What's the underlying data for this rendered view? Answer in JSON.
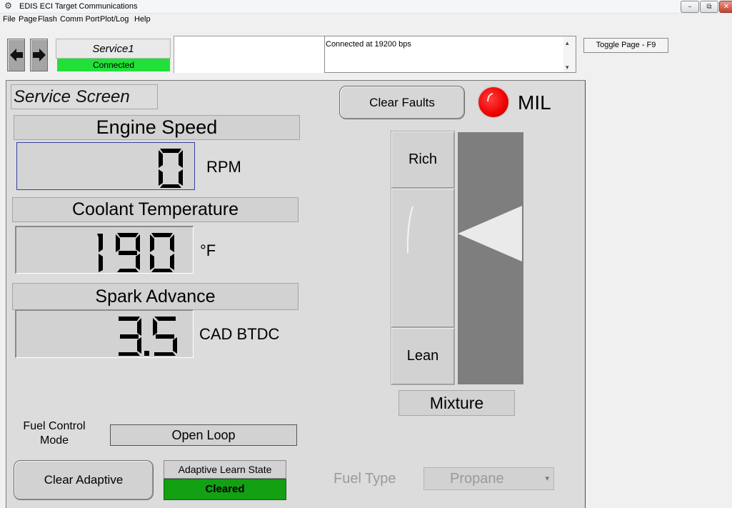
{
  "window": {
    "title": "EDIS ECI Target Communications",
    "app_icon": "app-logo-icon",
    "controls": {
      "minimize": "–",
      "maximize": "⧉",
      "close": "✕"
    }
  },
  "menu": [
    "File",
    "Page",
    "Flash",
    "Comm Port",
    "Plot/Log",
    "Help"
  ],
  "toolbar": {
    "back_icon": "arrow-left-icon",
    "forward_icon": "arrow-right-icon",
    "page_name": "Service1",
    "page_status": "Connected",
    "log_text": "Connected at 19200 bps",
    "log_scroll_up": "▴",
    "log_scroll_down": "▾",
    "toggle_page": "Toggle Page - F9"
  },
  "service": {
    "title": "Service Screen",
    "engine_speed": {
      "label": "Engine Speed",
      "value": "0",
      "unit": "RPM"
    },
    "coolant_temp": {
      "label": "Coolant Temperature",
      "value": "190",
      "unit": "°F"
    },
    "spark_advance": {
      "label": "Spark Advance",
      "value": "3.5",
      "unit": "CAD BTDC"
    },
    "fuel_control_mode": {
      "label": "Fuel Control Mode",
      "value": "Open Loop"
    },
    "clear_adaptive": "Clear Adaptive",
    "adaptive_learn_state": {
      "label": "Adaptive Learn State",
      "value": "Cleared"
    },
    "fuel_type": {
      "label": "Fuel Type",
      "value": "Propane",
      "dropdown_icon": "▾"
    },
    "clear_faults": "Clear Faults",
    "mil": {
      "label": "MIL",
      "lamp_color": "#ee0000"
    },
    "mixture": {
      "label": "Mixture",
      "rich": "Rich",
      "lean": "Lean",
      "indicator_level": 0.5
    }
  }
}
